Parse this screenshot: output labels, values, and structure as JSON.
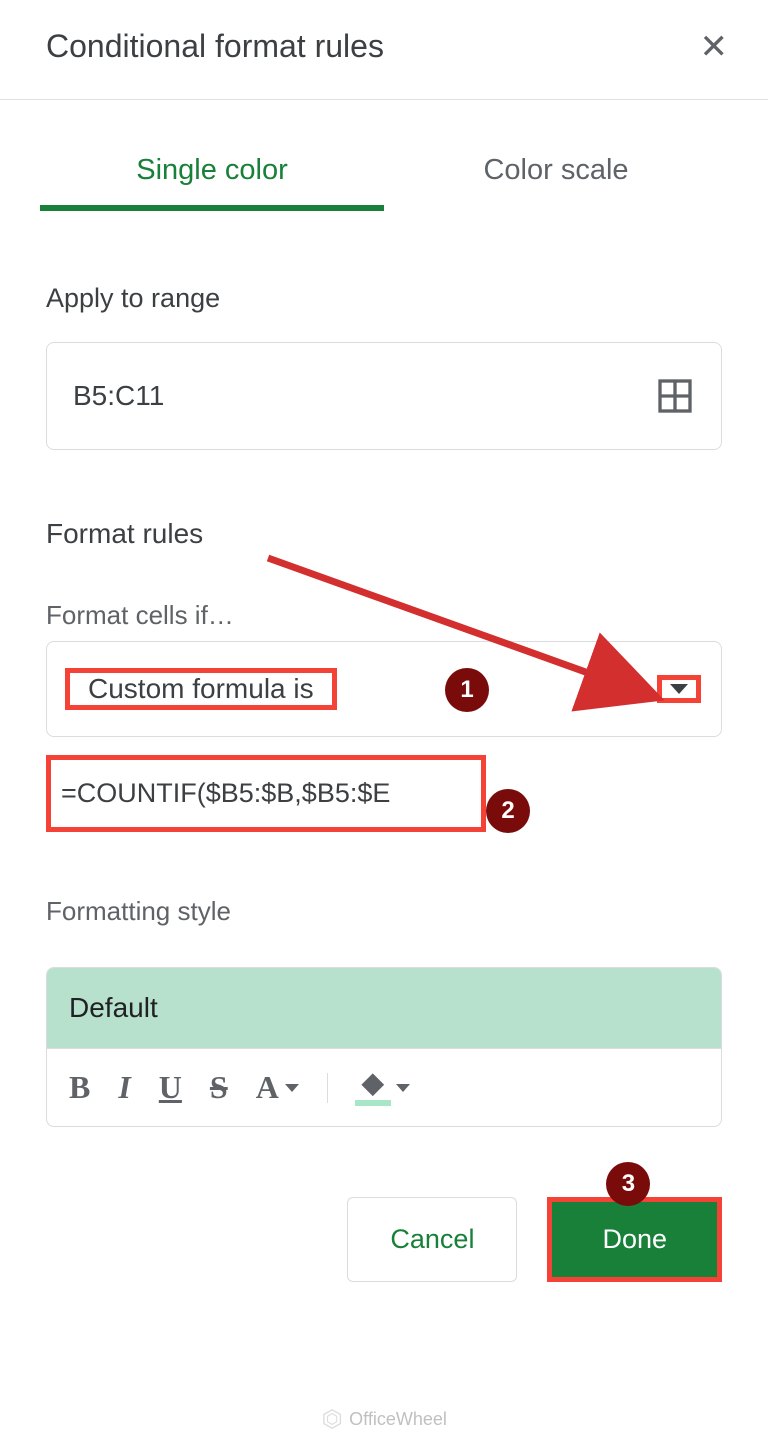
{
  "header": {
    "title": "Conditional format rules"
  },
  "tabs": {
    "single": "Single color",
    "scale": "Color scale"
  },
  "range": {
    "label": "Apply to range",
    "value": "B5:C11"
  },
  "rules": {
    "title": "Format rules",
    "sub": "Format cells if…",
    "dropdown": "Custom formula is",
    "formula": "=COUNTIF($B5:$B,$B5:$E"
  },
  "style": {
    "label": "Formatting style",
    "preview": "Default",
    "bold": "B",
    "italic": "I",
    "underline": "U",
    "strike": "S",
    "textcolor": "A",
    "fill": "◆"
  },
  "buttons": {
    "cancel": "Cancel",
    "done": "Done"
  },
  "badges": {
    "one": "1",
    "two": "2",
    "three": "3"
  },
  "watermark": "OfficeWheel"
}
